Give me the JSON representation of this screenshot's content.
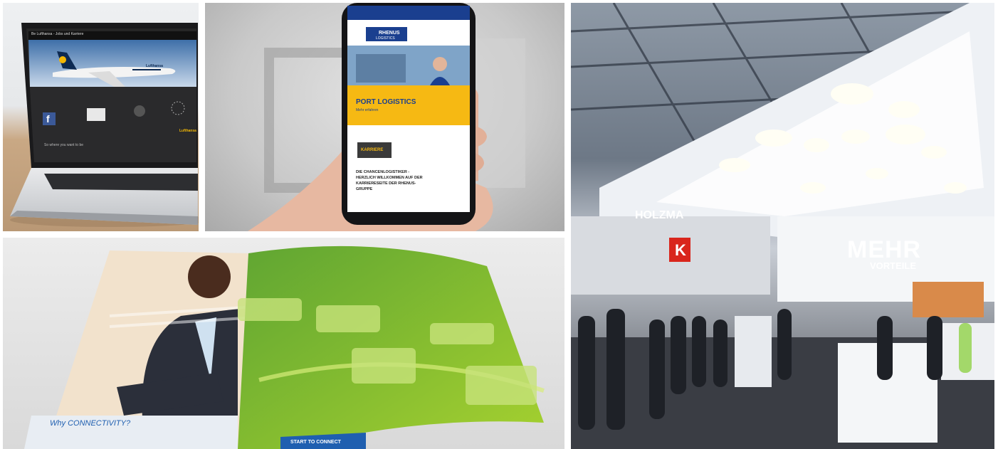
{
  "laptop_screen": {
    "header_title": "Be Lufthansa - Jobs und Karriere",
    "airline_name": "Lufthansa",
    "footer_text": "So where you want to be",
    "footer_brand": "Lufthansa"
  },
  "phone_screen": {
    "brand_line1": "RHENUS",
    "brand_line2": "LOGISTICS",
    "banner_title": "PORT LOGISTICS",
    "banner_subtitle": "Mehr erfahren",
    "button_label": "KARRIERE",
    "body_text_lines": [
      "DIE CHANCENLOGISTIKER -",
      "HERZLICH WILLKOMMEN AUF DER",
      "KARRIERESEITE DER RHENUS-",
      "GRUPPE"
    ]
  },
  "brochure": {
    "left_title_prefix": "Why ",
    "left_title_highlight": "CONNECTIVITY",
    "left_title_suffix": "?",
    "right_footer": "START TO CONNECT"
  },
  "booth": {
    "sign_main": "MEHR",
    "sign_sub": "VORTEILE",
    "header_sign": "HOLZMA",
    "k_logo": "K"
  },
  "colors": {
    "lufthansa_yellow": "#f2b705",
    "rhenus_blue": "#1a3f8f",
    "rhenus_yellow": "#f6b913",
    "leaf_green": "#8cbf2a",
    "brochure_blue": "#1f5fb0",
    "booth_white": "#f4f6f8",
    "k_red": "#d9261c"
  }
}
